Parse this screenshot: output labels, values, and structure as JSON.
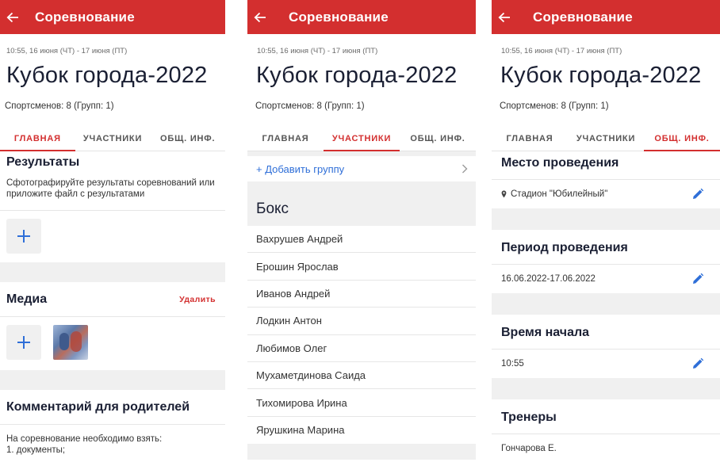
{
  "colors": {
    "accent": "#d32f2f",
    "blue": "#2f6fd8"
  },
  "icons": {
    "back": "arrow-back-icon",
    "edit": "pencil-icon",
    "location": "location-pin-icon",
    "chevron": "chevron-right-icon",
    "add": "plus-icon"
  },
  "appbar": {
    "title": "Соревнование"
  },
  "header": {
    "dates": "10:55, 16 июня (ЧТ) - 17 июня (ПТ)",
    "title": "Кубок города-2022",
    "counts": "Спортсменов: 8 (Групп: 1)"
  },
  "tabs": [
    "ГЛАВНАЯ",
    "УЧАСТНИКИ",
    "ОБЩ. ИНФ."
  ],
  "main": {
    "results_title": "Результаты",
    "results_hint": "Сфотографируйте результаты соревнований или приложите файл с результатами",
    "media_title": "Медиа",
    "media_delete": "Удалить",
    "comment_title": "Комментарий для родителей",
    "comment_text_1": "На соревнование необходимо взять:",
    "comment_text_2": "1. документы;"
  },
  "participants": {
    "add_group": "+ Добавить группу",
    "group_name": "Бокс",
    "members": [
      "Вахрушев Андрей",
      "Ерошин Ярослав",
      "Иванов Андрей",
      "Лодкин Антон",
      "Любимов Олег",
      "Мухаметдинова Саида",
      "Тихомирова Ирина",
      "Ярушкина Марина"
    ]
  },
  "info": {
    "venue_title": "Место проведения",
    "venue_value": "Стадион \"Юбилейный\"",
    "period_title": "Период проведения",
    "period_value": "16.06.2022-17.06.2022",
    "start_title": "Время начала",
    "start_value": "10:55",
    "coaches_title": "Тренеры",
    "coaches_value": "Гончарова Е."
  }
}
